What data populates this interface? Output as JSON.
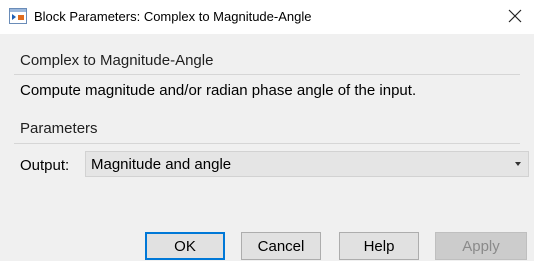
{
  "window": {
    "title": "Block Parameters: Complex to Magnitude-Angle",
    "app_icon": "simulink-block-icon",
    "close_icon": "close-icon"
  },
  "block": {
    "name": "Complex to Magnitude-Angle",
    "description": "Compute magnitude and/or radian phase angle of the input."
  },
  "parameters": {
    "section_label": "Parameters",
    "output_label": "Output:",
    "output_value": "Magnitude and angle"
  },
  "buttons": {
    "ok": "OK",
    "cancel": "Cancel",
    "help": "Help",
    "apply": "Apply"
  },
  "colors": {
    "accent": "#0078d7",
    "panel_bg": "#f0f0f0",
    "disabled_text": "#8a8a8a"
  }
}
